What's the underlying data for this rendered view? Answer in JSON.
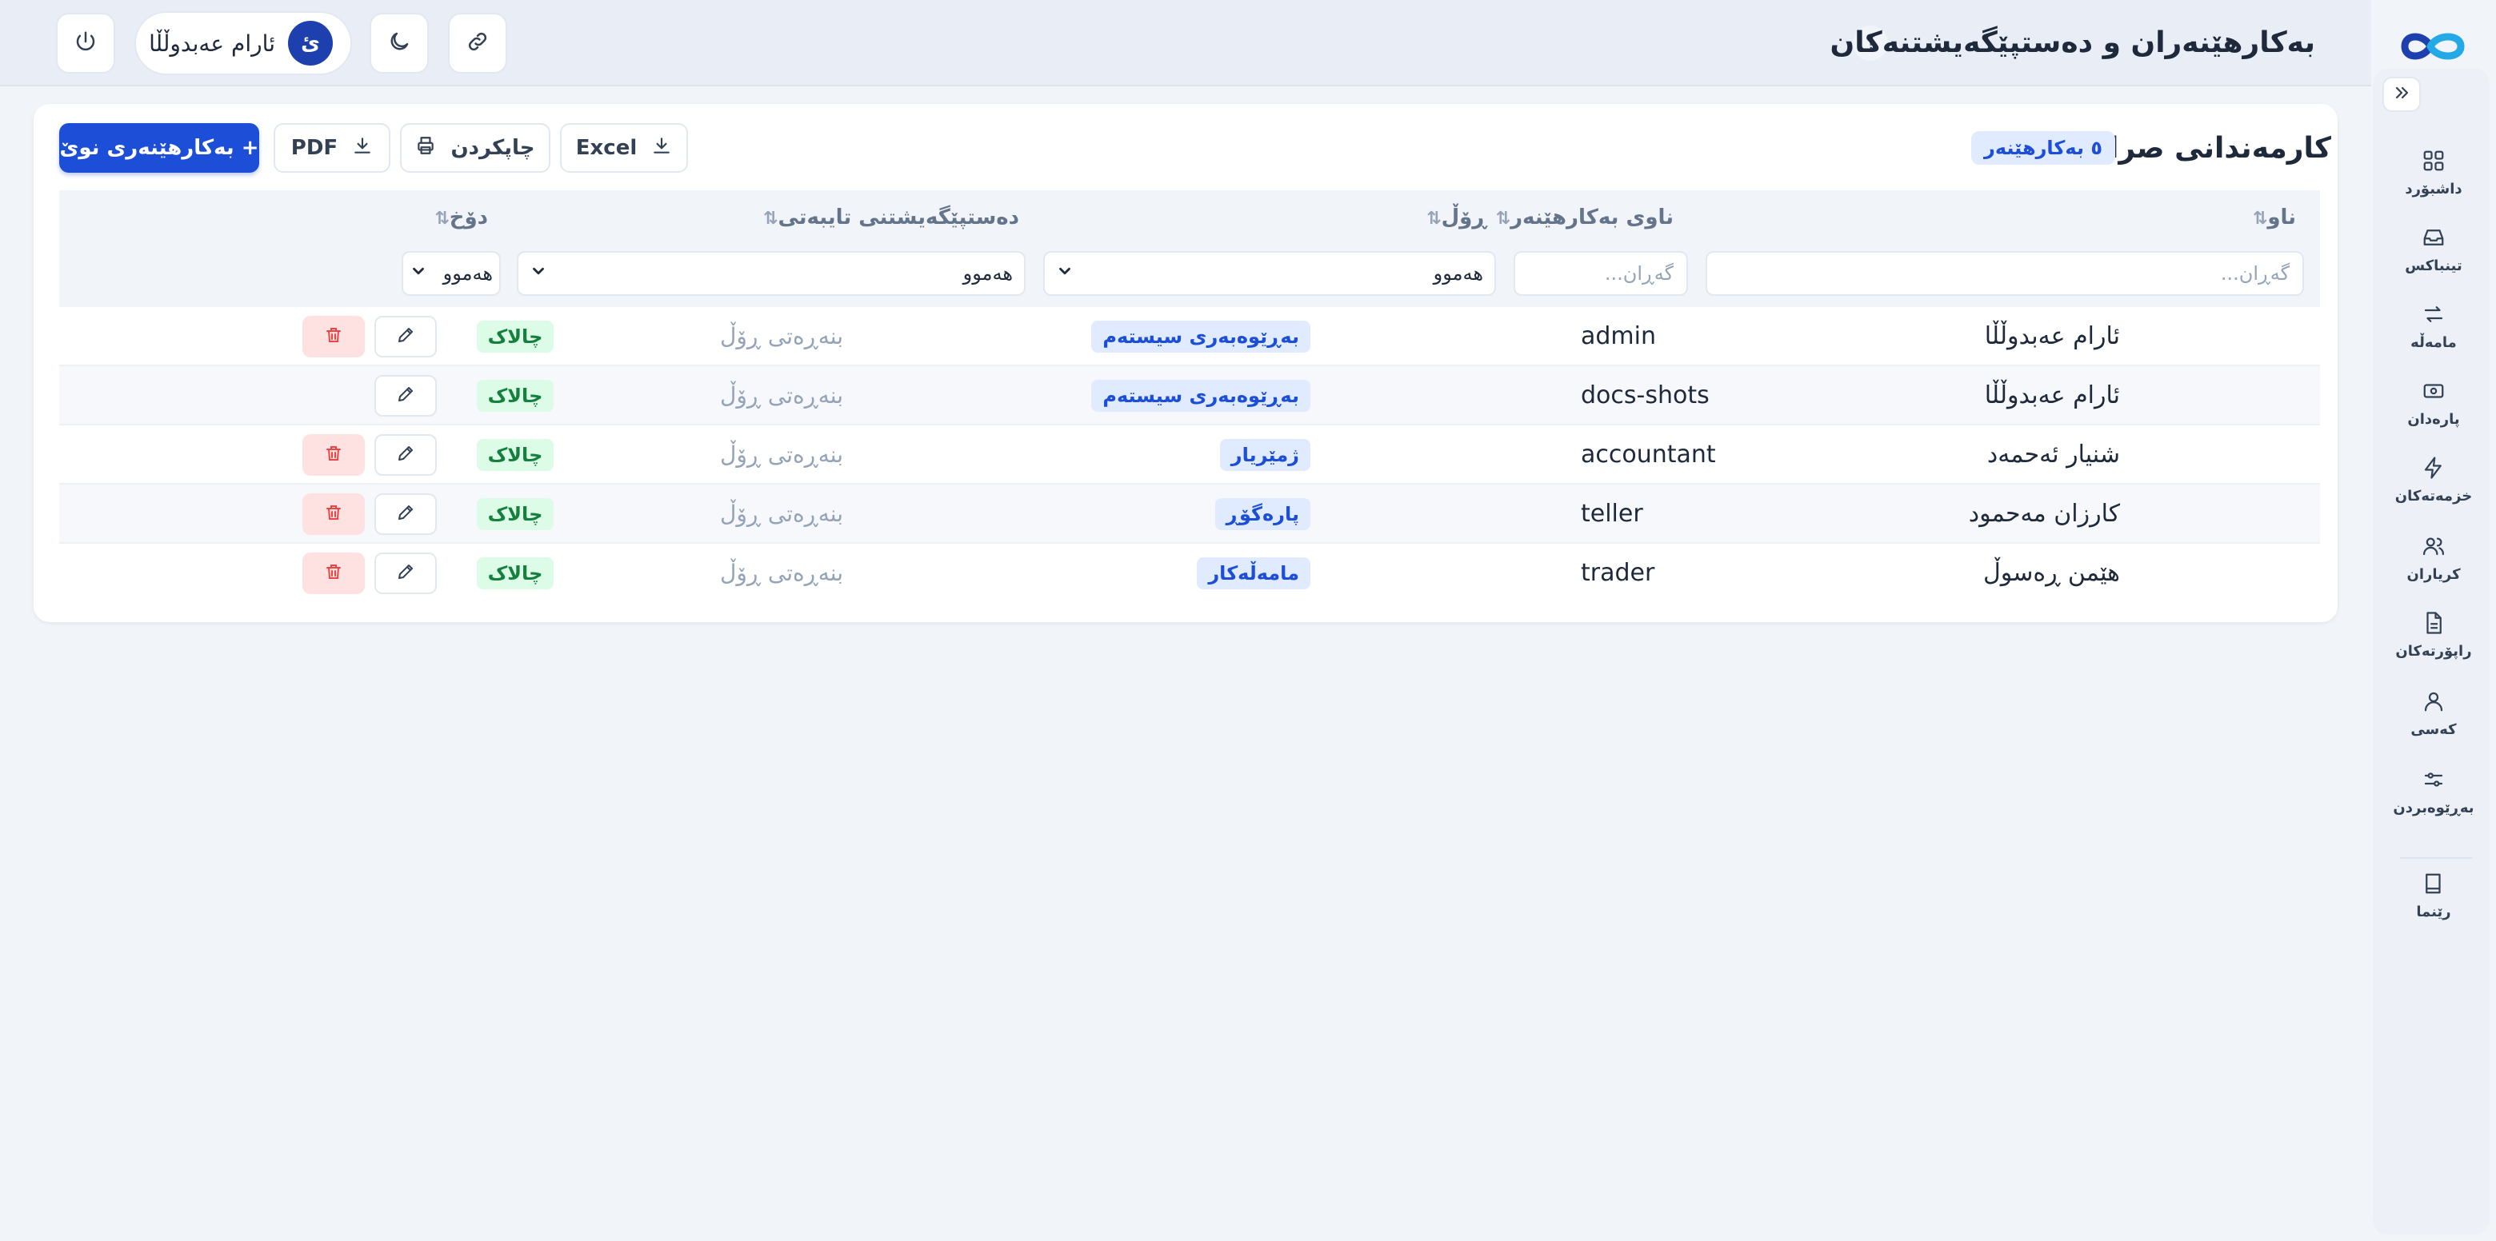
{
  "header": {
    "title": "بەکارهێنەران و دەستپێگەیشتنەکان",
    "help": "؟",
    "user_name": "ئارام عەبدوڵڵا",
    "user_initial": "ئ"
  },
  "sidebar": {
    "items": [
      {
        "label": "داشبۆرد",
        "icon": "dashboard-icon"
      },
      {
        "label": "تینباکس",
        "icon": "inbox-icon"
      },
      {
        "label": "مامەڵە",
        "icon": "transfer-icon"
      },
      {
        "label": "پارەدان",
        "icon": "cash-icon"
      },
      {
        "label": "خزمەتەکان",
        "icon": "bolt-icon"
      },
      {
        "label": "کریاران",
        "icon": "users-icon"
      },
      {
        "label": "راپۆرتەکان",
        "icon": "report-icon"
      },
      {
        "label": "کەسی",
        "icon": "person-icon"
      },
      {
        "label": "بەڕێوەبردن",
        "icon": "sliders-icon"
      },
      {
        "label": "رێنما",
        "icon": "book-icon"
      }
    ]
  },
  "card": {
    "title": "کارمەندانی صرافی",
    "count_badge": "٥ بەکارهێنەر",
    "excel_label": "Excel",
    "print_label": "چاپکردن",
    "pdf_label": "PDF",
    "new_user_label": "+ بەکارهێنەری نوێ"
  },
  "table": {
    "columns": {
      "name": "ناو",
      "username": "ناوی بەکارهێنەر",
      "role": "ڕۆڵ",
      "permissions": "دەستپێگەیشتنی تایبەتی",
      "status": "دۆخ"
    },
    "filters": {
      "name_placeholder": "گەڕان...",
      "username_placeholder": "گەڕان...",
      "role_value": "هەموو",
      "permissions_value": "هەموو",
      "status_value": "هەموو"
    },
    "rows": [
      {
        "name": "ئارام عەبدوڵڵا",
        "username": "admin",
        "role": "بەڕێوەبەری سیستەم",
        "permissions": "بنەڕەتی ڕۆڵ",
        "status": "چالاک",
        "deletable": true
      },
      {
        "name": "ئارام عەبدوڵڵا",
        "username": "docs-shots",
        "role": "بەڕێوەبەری سیستەم",
        "permissions": "بنەڕەتی ڕۆڵ",
        "status": "چالاک",
        "deletable": false
      },
      {
        "name": "شنیار ئەحمەد",
        "username": "accountant",
        "role": "ژمێریار",
        "permissions": "بنەڕەتی ڕۆڵ",
        "status": "چالاک",
        "deletable": true
      },
      {
        "name": "کارزان مەحمود",
        "username": "teller",
        "role": "پارەگۆڕ",
        "permissions": "بنەڕەتی ڕۆڵ",
        "status": "چالاک",
        "deletable": true
      },
      {
        "name": "هێمن ڕەسوڵ",
        "username": "trader",
        "role": "مامەڵەکار",
        "permissions": "بنەڕەتی ڕۆڵ",
        "status": "چالاک",
        "deletable": true
      }
    ]
  },
  "colors": {
    "primary": "#1d4ed8",
    "status_active_bg": "#dcfce7",
    "status_active_text": "#15803d",
    "danger_bg": "#fee2e2",
    "danger_icon": "#ef4444"
  }
}
